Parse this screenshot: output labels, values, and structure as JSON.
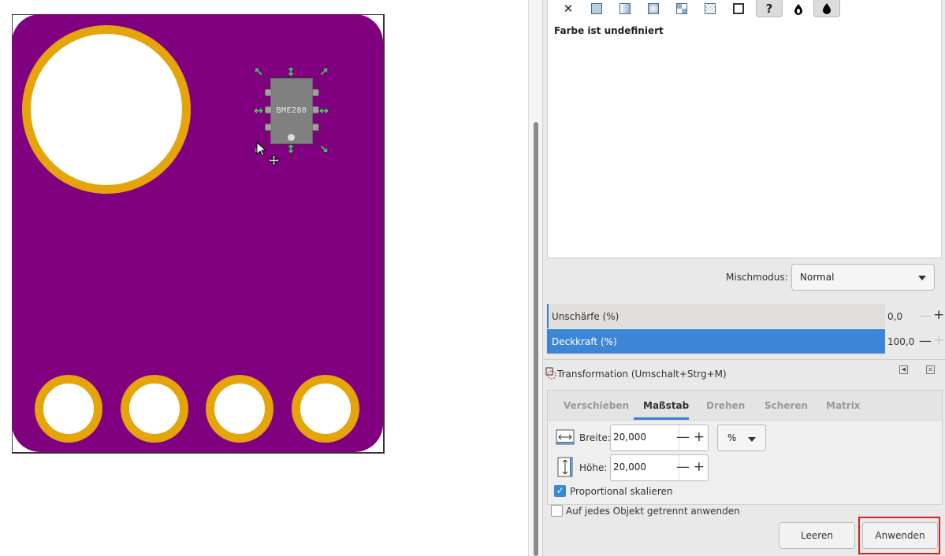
{
  "canvas": {
    "pcb_color": "#800080",
    "pad_color": "#e5a40a",
    "chip_label": "BME280",
    "selection_handle_color": "#33dd55"
  },
  "fill_stroke": {
    "paint_buttons": [
      "no-paint",
      "flat-color",
      "linear-gradient",
      "radial-gradient",
      "mesh-gradient",
      "pattern",
      "swatch",
      "unset",
      "fill-rule-evenodd",
      "fill-rule-nonzero"
    ],
    "unset_glyph": "?",
    "status": "Farbe ist undefiniert",
    "blend_label": "Mischmodus:",
    "blend_value": "Normal",
    "blur_label": "Unschärfe (%)",
    "blur_value": "0,0",
    "opacity_label": "Deckkraft (%)",
    "opacity_value": "100,0"
  },
  "transform": {
    "title": "Transformation (Umschalt+Strg+M)",
    "tabs": [
      "Verschieben",
      "Maßstab",
      "Drehen",
      "Scheren",
      "Matrix"
    ],
    "active_tab": "Maßstab",
    "width_label": "Breite:",
    "width_value": "20,000",
    "height_label": "Höhe:",
    "height_value": "20,000",
    "unit": "%",
    "proportional_label": "Proportional skalieren",
    "proportional_checked": true,
    "separately_label": "Auf jedes Objekt getrennt anwenden",
    "separately_checked": false,
    "clear_button": "Leeren",
    "apply_button": "Anwenden"
  },
  "colors": {
    "accent": "#3d86d6",
    "highlight": "#d42020"
  }
}
